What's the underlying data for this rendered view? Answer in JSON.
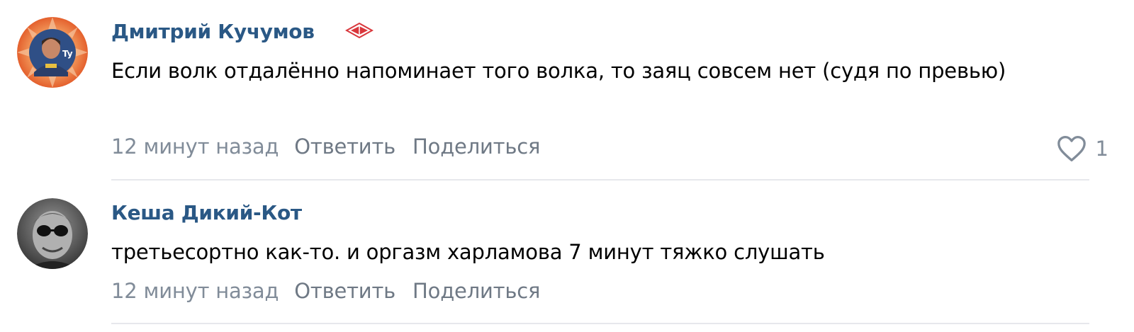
{
  "comments": [
    {
      "author": "Дмитрий Кучумов",
      "avatar_icon": "user-avatar-orange-rays",
      "badge_icon": "spartak-logo-icon",
      "text": "Если волк отдалённо напоминает того волка, то заяц совсем нет (судя по превью)",
      "time": "12 минут назад",
      "reply_label": "Ответить",
      "share_label": "Поделиться",
      "like_icon": "heart-outline-icon",
      "likes": "1"
    },
    {
      "author": "Кеша Дикий-Кот",
      "avatar_icon": "user-avatar-bw-sunglasses",
      "text": "третьесортно как-то. и оргазм харламова 7 минут тяжко слушать",
      "time": "12 минут назад",
      "reply_label": "Ответить",
      "share_label": "Поделиться"
    }
  ],
  "colors": {
    "author_link": "#2a5885",
    "meta": "#818c99",
    "divider": "#e7e8ec",
    "badge_red": "#d9373c"
  }
}
